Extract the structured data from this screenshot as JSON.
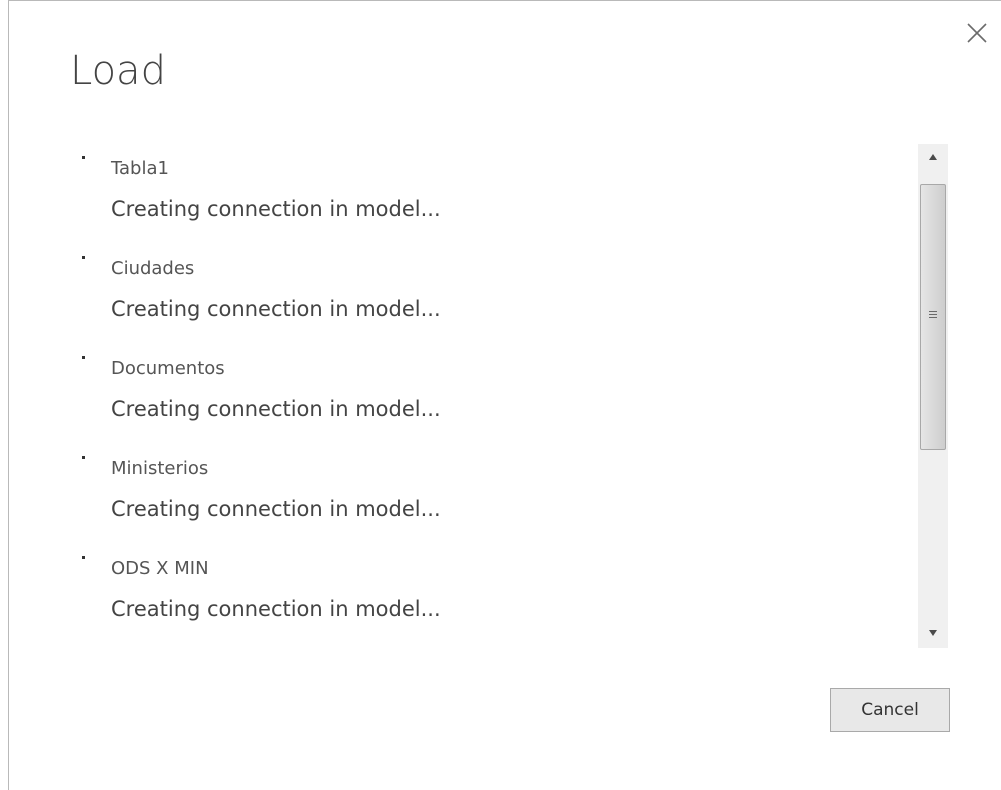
{
  "dialog": {
    "title": "Load",
    "cancel_label": "Cancel"
  },
  "items": [
    {
      "name": "Tabla1",
      "status": "Creating connection in model..."
    },
    {
      "name": "Ciudades",
      "status": "Creating connection in model..."
    },
    {
      "name": "Documentos",
      "status": "Creating connection in model..."
    },
    {
      "name": "Ministerios",
      "status": "Creating connection in model..."
    },
    {
      "name": "ODS X MIN",
      "status": "Creating connection in model..."
    }
  ],
  "icons": {
    "close": "close-icon",
    "scroll_up": "scroll-up-arrow-icon",
    "scroll_down": "scroll-down-arrow-icon",
    "grip": "scroll-grip-icon"
  },
  "colors": {
    "border": "#b9b9b9",
    "text": "#444444",
    "button_bg": "#e8e8e8"
  }
}
